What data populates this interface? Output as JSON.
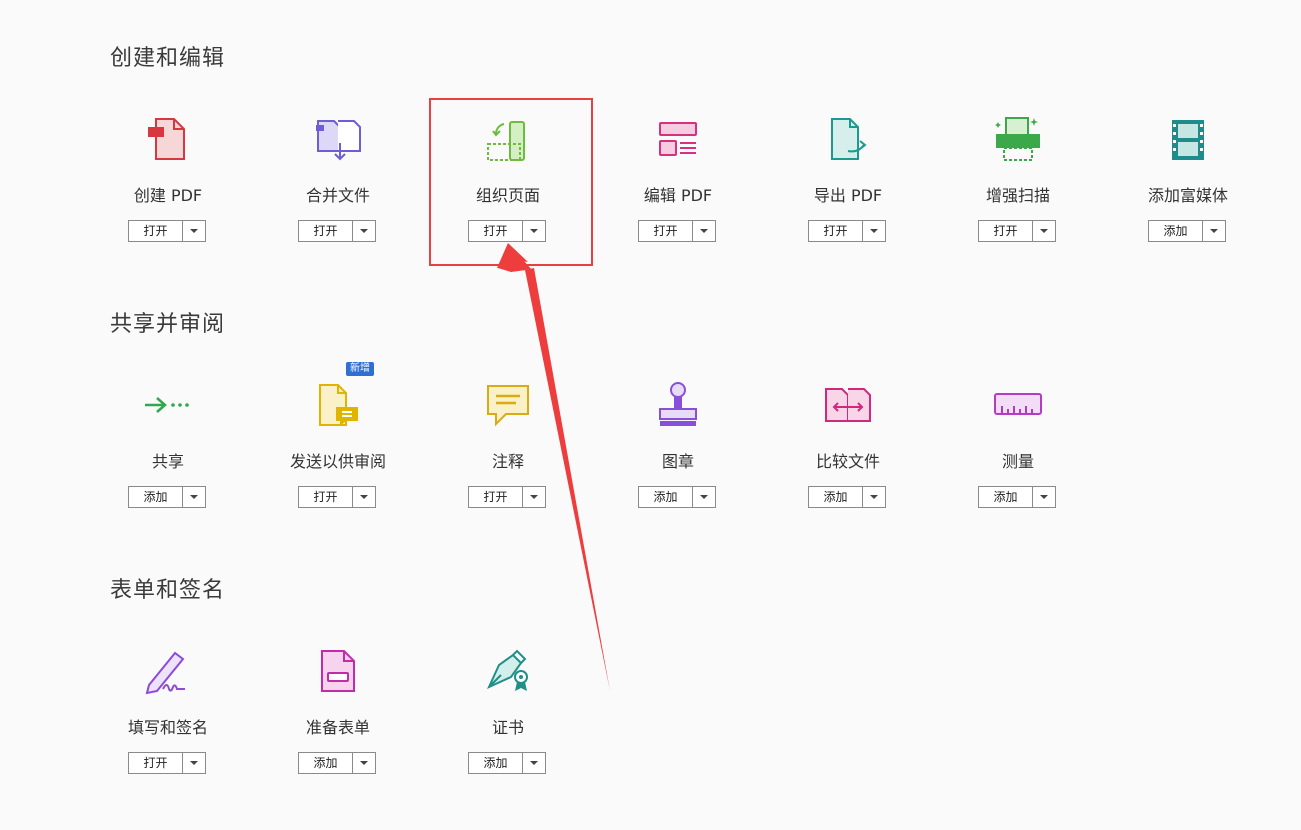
{
  "sections": [
    {
      "title": "创建和编辑"
    },
    {
      "title": "共享并审阅"
    },
    {
      "title": "表单和签名"
    }
  ],
  "tools": {
    "create_pdf": {
      "label": "创建 PDF",
      "button": "打开",
      "icon": "create-pdf-icon"
    },
    "combine": {
      "label": "合并文件",
      "button": "打开",
      "icon": "combine-files-icon"
    },
    "organize": {
      "label": "组织页面",
      "button": "打开",
      "icon": "organize-pages-icon"
    },
    "edit_pdf": {
      "label": "编辑 PDF",
      "button": "打开",
      "icon": "edit-pdf-icon"
    },
    "export_pdf": {
      "label": "导出 PDF",
      "button": "打开",
      "icon": "export-pdf-icon"
    },
    "enhance_scan": {
      "label": "增强扫描",
      "button": "打开",
      "icon": "enhance-scan-icon"
    },
    "rich_media": {
      "label": "添加富媒体",
      "button": "添加",
      "icon": "rich-media-icon"
    },
    "share": {
      "label": "共享",
      "button": "添加",
      "icon": "share-icon"
    },
    "send_review": {
      "label": "发送以供审阅",
      "button": "打开",
      "icon": "send-review-icon",
      "badge": "新增"
    },
    "comment": {
      "label": "注释",
      "button": "打开",
      "icon": "comment-icon"
    },
    "stamp": {
      "label": "图章",
      "button": "添加",
      "icon": "stamp-icon"
    },
    "compare": {
      "label": "比较文件",
      "button": "添加",
      "icon": "compare-files-icon"
    },
    "measure": {
      "label": "测量",
      "button": "添加",
      "icon": "measure-icon"
    },
    "fill_sign": {
      "label": "填写和签名",
      "button": "打开",
      "icon": "fill-sign-icon"
    },
    "prepare_form": {
      "label": "准备表单",
      "button": "添加",
      "icon": "prepare-form-icon"
    },
    "certificates": {
      "label": "证书",
      "button": "添加",
      "icon": "certificate-icon"
    }
  },
  "colors": {
    "highlight": "#e84040",
    "badge": "#2f6fd1"
  }
}
